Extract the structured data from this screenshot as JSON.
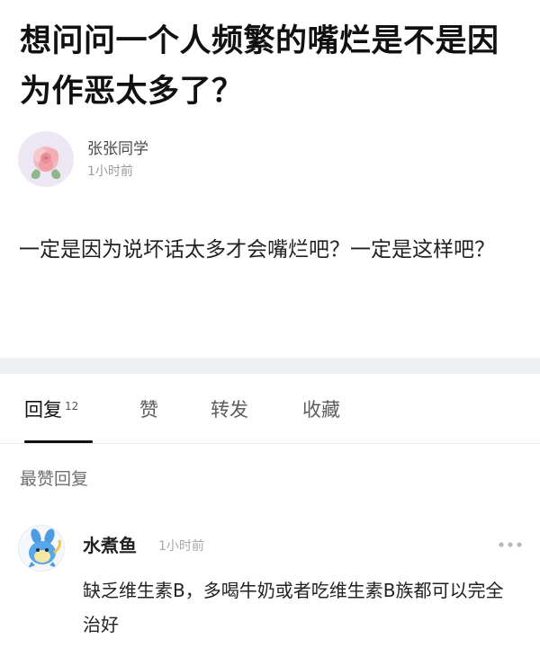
{
  "post": {
    "title": "想问问一个人频繁的嘴烂是不是因为作恶太多了？",
    "author": {
      "name": "张张同学",
      "time": "1小时前",
      "avatar_icon": "rose-avatar-icon"
    },
    "body": "一定是因为说坏话太多才会嘴烂吧？一定是这样吧？"
  },
  "tabs": [
    {
      "label": "回复",
      "count": "12",
      "active": true
    },
    {
      "label": "赞"
    },
    {
      "label": "转发"
    },
    {
      "label": "收藏"
    }
  ],
  "replies_section": {
    "label": "最赞回复"
  },
  "reply": {
    "name": "水煮鱼",
    "time": "1小时前",
    "avatar_icon": "blue-cartoon-avatar-icon",
    "body": "缺乏维生素B，多喝牛奶或者吃维生素B族都可以完全治好"
  },
  "colors": {
    "divider": "#eef0f3",
    "active_tab": "#111111",
    "muted_text": "#9b9b9b"
  }
}
